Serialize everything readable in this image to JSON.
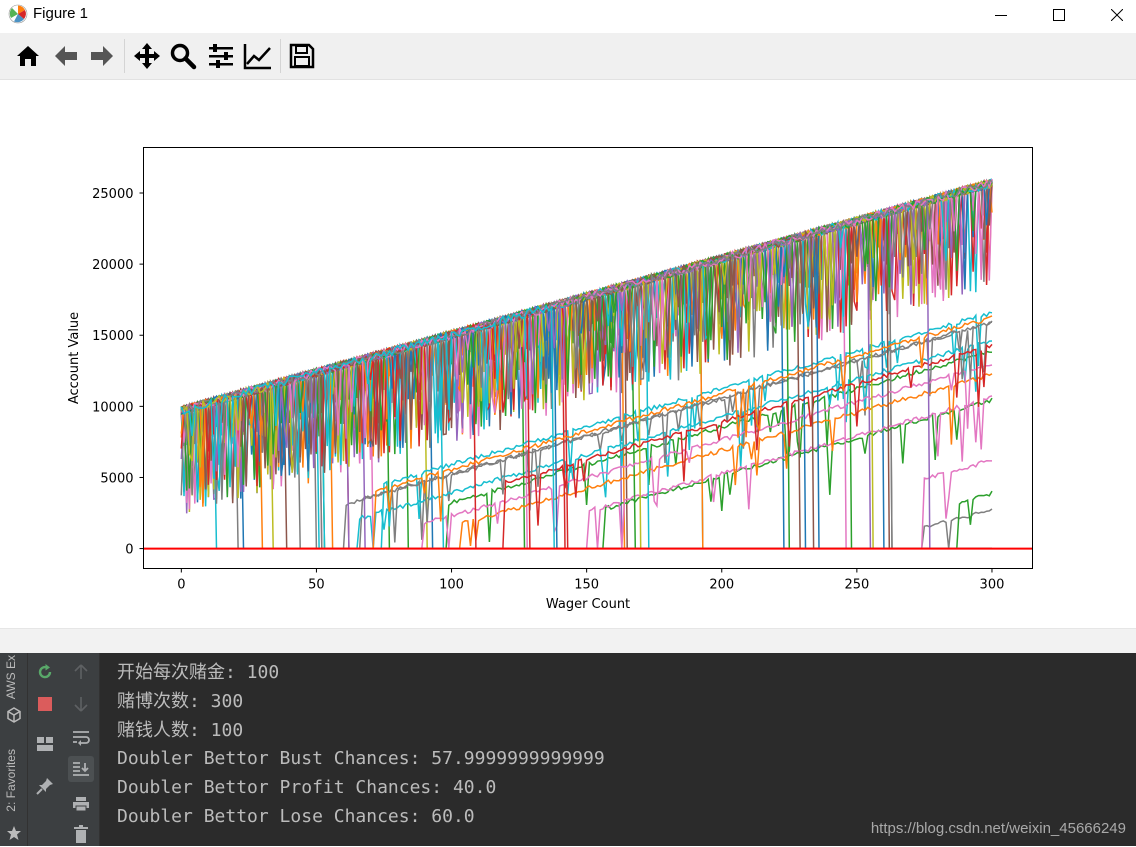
{
  "window": {
    "title": "Figure 1"
  },
  "toolbar": {
    "buttons": [
      "home-icon",
      "back-arrow-icon",
      "forward-arrow-icon",
      "pan-icon",
      "zoom-icon",
      "configure-subplots-icon",
      "edit-axis-icon",
      "save-icon"
    ]
  },
  "chart_data": {
    "type": "line",
    "title": "",
    "xlabel": "Wager Count",
    "ylabel": "Account Value",
    "xlim": [
      -14,
      315
    ],
    "ylim": [
      -1400,
      28200
    ],
    "xticks": [
      0,
      50,
      100,
      150,
      200,
      250,
      300
    ],
    "yticks": [
      0,
      5000,
      10000,
      15000,
      20000,
      25000
    ],
    "legend": "none",
    "grid": false,
    "num_series": 100,
    "series_description_x": [
      0,
      300
    ],
    "start_value": 10000,
    "upper_envelope_end": 26000,
    "hline": {
      "y": 0,
      "color": "#ff0000"
    },
    "palette": [
      "#1f77b4",
      "#ff7f0e",
      "#2ca02c",
      "#d62728",
      "#9467bd",
      "#8c564b",
      "#e377c2",
      "#7f7f7f",
      "#bcbd22",
      "#17becf"
    ]
  },
  "console": {
    "lines": [
      "开始每次赌金: 100",
      "赌博次数: 300",
      "赌钱人数: 100",
      "Doubler Bettor Bust Chances: 57.9999999999999",
      "Doubler Bettor Profit Chances: 40.0",
      "Doubler Bettor Lose Chances: 60.0"
    ]
  },
  "side_tabs": {
    "aws": "AWS Ex",
    "favorites": "2: Favorites"
  },
  "watermark": "https://blog.csdn.net/weixin_45666249"
}
